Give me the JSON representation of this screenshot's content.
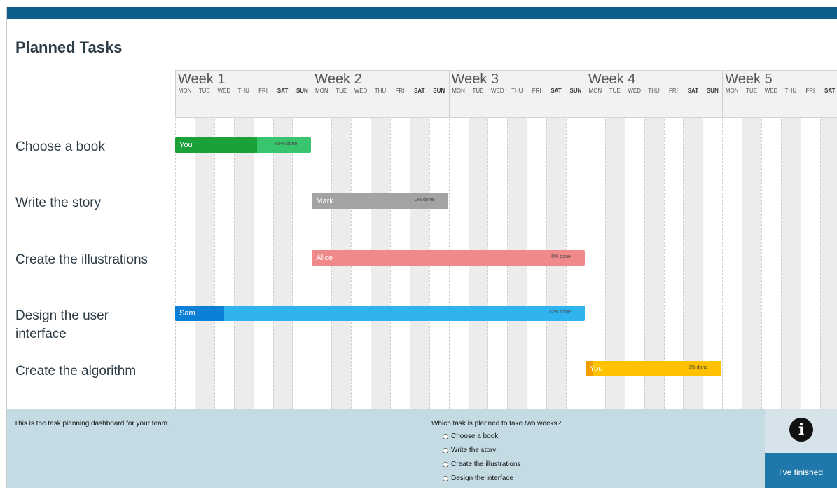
{
  "page": {
    "title": "Planned Tasks"
  },
  "weeks": [
    "Week 1",
    "Week 2",
    "Week 3",
    "Week 4",
    "Week 5"
  ],
  "days": [
    "MON",
    "TUE",
    "WED",
    "THU",
    "FRI",
    "SAT",
    "SUN"
  ],
  "tasks": [
    {
      "name": "Choose a book",
      "owner": "You",
      "done_text": "60% done",
      "progress": 0.6,
      "color": "#39c56e",
      "progress_color": "#1aa137"
    },
    {
      "name": "Write the story",
      "owner": "Mark",
      "done_text": "0% done",
      "progress": 0,
      "color": "#a3a3a3",
      "progress_color": "#8c8c8c"
    },
    {
      "name": "Create the illustrations",
      "owner": "Alice",
      "done_text": "0% done",
      "progress": 0,
      "color": "#f08a8a",
      "progress_color": "#e46f6f"
    },
    {
      "name": "Design the user interface",
      "owner": "Sam",
      "done_text": "12% done",
      "progress": 0.12,
      "color": "#2fb3ef",
      "progress_color": "#0c7fd6"
    },
    {
      "name": "Create the algorithm",
      "owner": "You",
      "done_text": "5% done",
      "progress": 0.05,
      "color": "#ffc100",
      "progress_color": "#f29c00"
    }
  ],
  "panel": {
    "description": "This is the task planning dashboard for your team.",
    "question": "Which task is planned to take two weeks?",
    "options": [
      "Choose a book",
      "Write the story",
      "Create the illustrations",
      "Design the interface"
    ]
  },
  "info_icon": "info-icon",
  "finish_button": "I've finished",
  "colors": {
    "topbar": "#0d5e8a",
    "panel": "#c4dbe4",
    "finish": "#1f78a9"
  }
}
